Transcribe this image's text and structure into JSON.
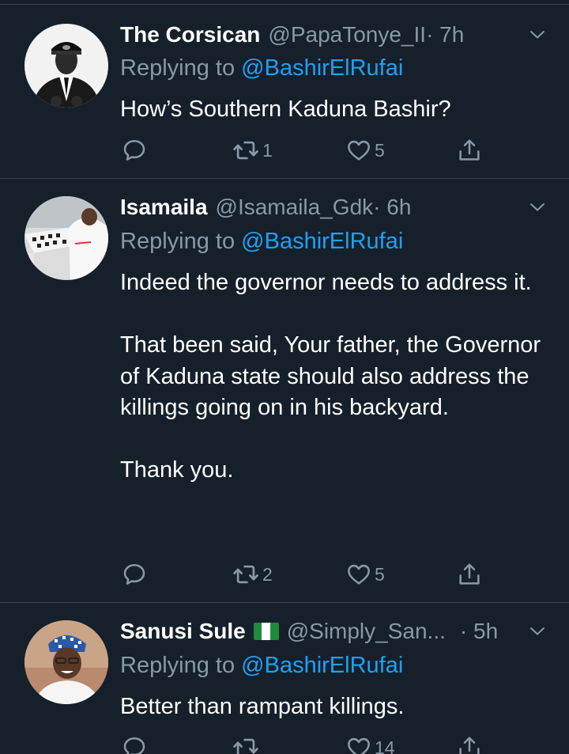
{
  "colors": {
    "background": "#15202b",
    "divider": "#38444d",
    "secondary_text": "#8899a6",
    "mention": "#1da1f2"
  },
  "tweets": [
    {
      "name": "The Corsican",
      "handle": "@PapaTonye_II",
      "time": "· 7h",
      "replying_prefix": "Replying to ",
      "replying_to": "@BashirElRufai",
      "text": [
        "How’s Southern Kaduna Bashir?"
      ],
      "reply_count": "",
      "retweet_count": "1",
      "like_count": "5",
      "icons": [
        "reply-icon",
        "retweet-icon",
        "like-icon",
        "share-icon",
        "chevron-down-icon"
      ]
    },
    {
      "name": "Isamaila",
      "handle": "@Isamaila_Gdk",
      "time": "· 6h",
      "replying_prefix": "Replying to ",
      "replying_to": "@BashirElRufai",
      "text": [
        "Indeed the governor needs to address it.",
        "That been said, Your father, the Governor of Kaduna state should also address the killings going on in his backyard.",
        "Thank you."
      ],
      "reply_count": "",
      "retweet_count": "2",
      "like_count": "5",
      "icons": [
        "reply-icon",
        "retweet-icon",
        "like-icon",
        "share-icon",
        "chevron-down-icon"
      ]
    },
    {
      "name": "Sanusi Sule",
      "handle": "@Simply_San...",
      "time": "· 5h",
      "replying_prefix": "Replying to ",
      "replying_to": "@BashirElRufai",
      "text": [
        "Better than rampant killings."
      ],
      "reply_count": "",
      "retweet_count": "",
      "like_count": "14",
      "icons": [
        "reply-icon",
        "retweet-icon",
        "like-icon",
        "share-icon",
        "chevron-down-icon",
        "nigeria-flag-icon"
      ]
    }
  ]
}
